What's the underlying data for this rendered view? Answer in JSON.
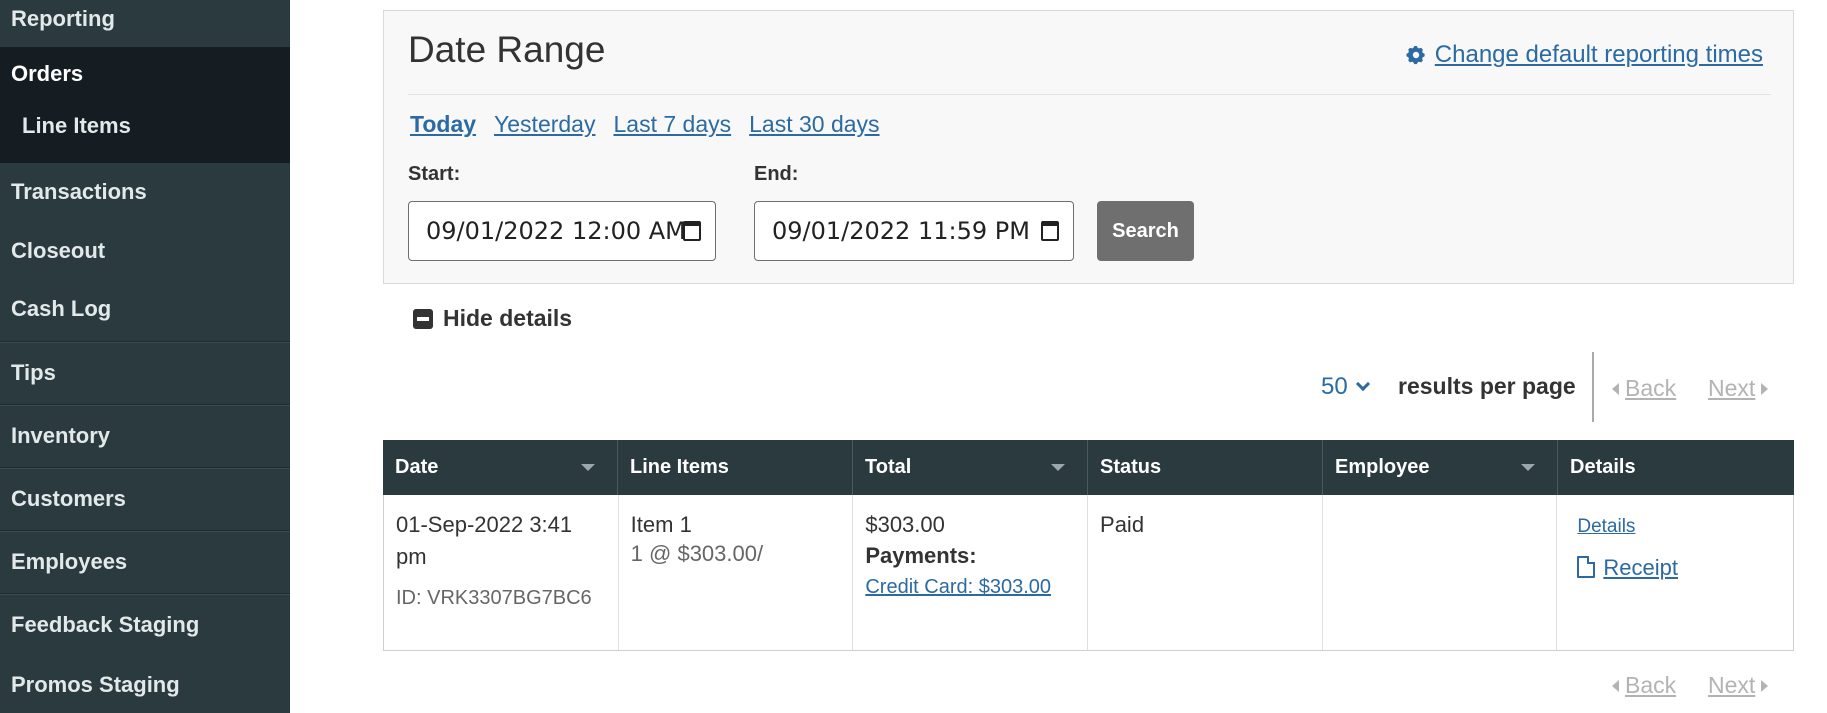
{
  "sidebar": {
    "items": [
      {
        "label": "Reporting"
      },
      {
        "label": "Orders"
      },
      {
        "label": "Line Items"
      },
      {
        "label": "Transactions"
      },
      {
        "label": "Closeout"
      },
      {
        "label": "Cash Log"
      },
      {
        "label": "Tips"
      },
      {
        "label": "Inventory"
      },
      {
        "label": "Customers"
      },
      {
        "label": "Employees"
      },
      {
        "label": "Feedback Staging"
      },
      {
        "label": "Promos Staging"
      }
    ]
  },
  "date_range": {
    "title": "Date Range",
    "change_link": "Change default reporting times",
    "quick_links": [
      "Today",
      "Yesterday",
      "Last 7 days",
      "Last 30 days"
    ],
    "start_label": "Start:",
    "start_value": "09/01/2022 12:00 AM",
    "end_label": "End:",
    "end_value": "09/01/2022 11:59 PM",
    "search_label": "Search"
  },
  "hide_details_label": "Hide details",
  "pager": {
    "per_page_value": "50",
    "per_page_label": "results per page",
    "back_label": "Back",
    "next_label": "Next"
  },
  "table": {
    "headers": [
      "Date",
      "Line Items",
      "Total",
      "Status",
      "Employee",
      "Details"
    ],
    "row": {
      "date": "01-Sep-2022 3:41 pm",
      "id": "ID: VRK3307BG7BC6",
      "item_name": "Item 1",
      "item_detail": "1 @ $303.00/",
      "total": "$303.00",
      "payments_label": "Payments:",
      "payment_link": "Credit Card: $303.00",
      "status": "Paid",
      "employee": "",
      "details_link": "Details",
      "receipt_link": "Receipt"
    }
  },
  "colors": {
    "sidebar_bg": "#2a3a3f",
    "sidebar_active_bg": "#161d22",
    "link": "#2b6aa3",
    "button_bg": "#6f6f6f"
  }
}
